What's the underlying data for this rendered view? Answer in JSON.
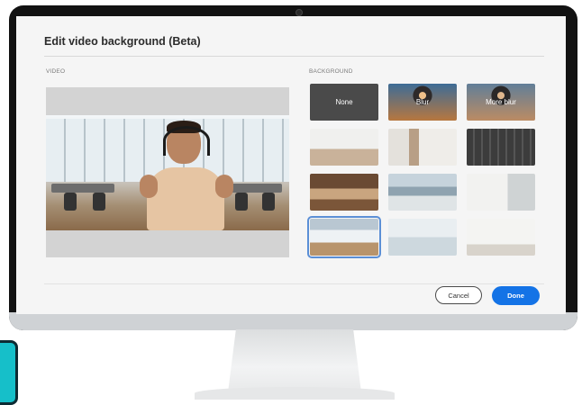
{
  "dialog": {
    "title": "Edit video background (Beta)",
    "video_label": "VIDEO",
    "background_label": "BACKGROUND"
  },
  "backgrounds": [
    {
      "label": "None",
      "selected": false
    },
    {
      "label": "Blur",
      "selected": false
    },
    {
      "label": "More blur",
      "selected": false
    },
    {
      "label": "",
      "selected": false
    },
    {
      "label": "",
      "selected": false
    },
    {
      "label": "",
      "selected": false
    },
    {
      "label": "",
      "selected": false
    },
    {
      "label": "",
      "selected": false
    },
    {
      "label": "",
      "selected": false
    },
    {
      "label": "",
      "selected": true
    },
    {
      "label": "",
      "selected": false
    },
    {
      "label": "",
      "selected": false
    }
  ],
  "buttons": {
    "cancel": "Cancel",
    "done": "Done"
  },
  "colors": {
    "accent": "#1473e6",
    "selection_outline": "#5b8fd6",
    "monitor_bezel": "#121212",
    "dock_tile": "#16bfc9"
  }
}
